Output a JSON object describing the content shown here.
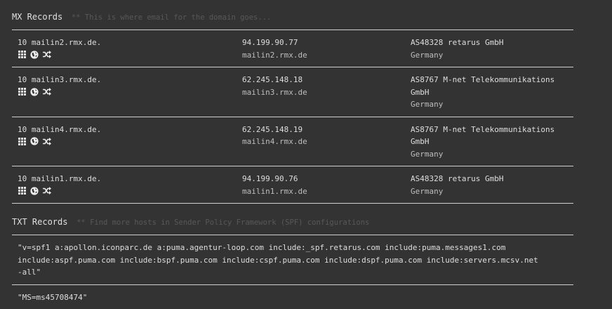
{
  "mx": {
    "title": "MX Records",
    "hint": "** This is where email for the domain goes...",
    "rows": [
      {
        "host": "10 mailin2.rmx.de.",
        "ip": "94.199.90.77",
        "reverse": "mailin2.rmx.de",
        "asn_lines": [
          "AS48328 retarus GmbH"
        ],
        "country": "Germany"
      },
      {
        "host": "10 mailin3.rmx.de.",
        "ip": "62.245.148.18",
        "reverse": "mailin3.rmx.de",
        "asn_lines": [
          "AS8767 M-net Telekommunikations",
          "GmbH"
        ],
        "country": "Germany"
      },
      {
        "host": "10 mailin4.rmx.de.",
        "ip": "62.245.148.19",
        "reverse": "mailin4.rmx.de",
        "asn_lines": [
          "AS8767 M-net Telekommunikations",
          "GmbH"
        ],
        "country": "Germany"
      },
      {
        "host": "10 mailin1.rmx.de.",
        "ip": "94.199.90.76",
        "reverse": "mailin1.rmx.de",
        "asn_lines": [
          "AS48328 retarus GmbH"
        ],
        "country": "Germany"
      }
    ],
    "icons": [
      "grid-icon",
      "globe-icon",
      "shuffle-icon"
    ]
  },
  "txt": {
    "title": "TXT Records",
    "hint": "** Find more hosts in Sender Policy Framework (SPF) configurations",
    "rows": [
      {
        "lines": [
          "\"v=spf1 a:apollon.iconparc.de a:puma.agentur-loop.com include:_spf.retarus.com include:puma.messages1.com",
          "include:aspf.puma.com include:bspf.puma.com include:cspf.puma.com include:dspf.puma.com include:servers.mcsv.net",
          "-all\""
        ]
      },
      {
        "lines": [
          "\"MS=ms45708474\""
        ]
      }
    ]
  }
}
